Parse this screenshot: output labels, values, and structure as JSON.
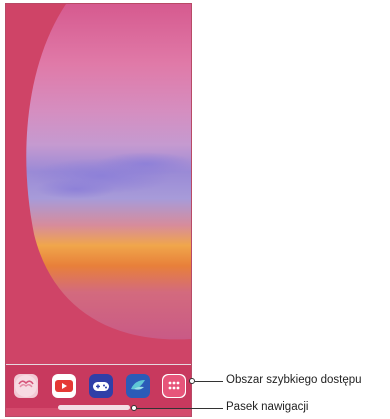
{
  "dock": {
    "apps": [
      {
        "name": "gallery",
        "icon": "gallery-icon",
        "color": "#f2c9d4"
      },
      {
        "name": "youtube",
        "icon": "youtube-play-icon",
        "color": "#e53935"
      },
      {
        "name": "games",
        "icon": "gamepad-icon",
        "color": "#2f3fa8"
      },
      {
        "name": "bird-app",
        "icon": "bird-icon",
        "color": "#2b5bb8"
      },
      {
        "name": "apps-drawer",
        "icon": "app-grid-icon",
        "color": "#e7557a"
      }
    ]
  },
  "annotations": {
    "quick_access_label": "Obszar szybkiego dostępu",
    "navigation_bar_label": "Pasek nawigacji"
  },
  "colors": {
    "phone_background": "#cf4467",
    "dock_background": "#c8395e",
    "sky_top": "#d95b93",
    "sunset": "#f2a93a"
  }
}
